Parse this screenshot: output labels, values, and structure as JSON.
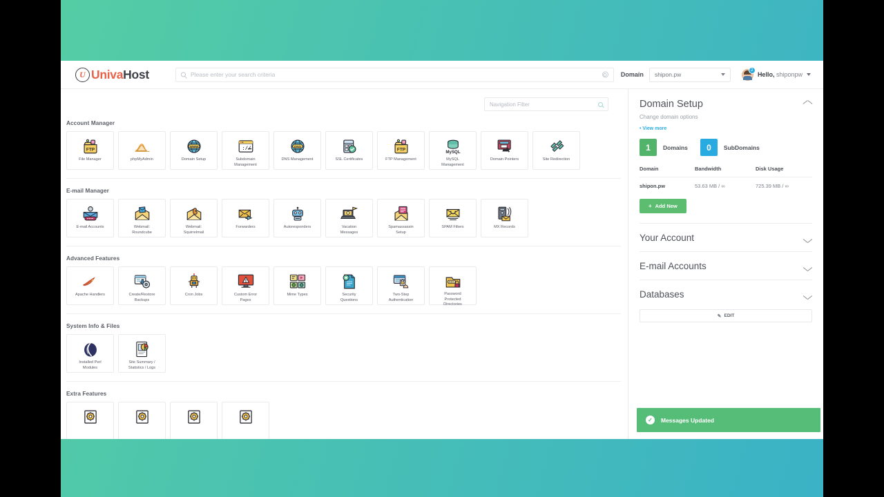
{
  "header": {
    "logo_mark": "U",
    "logo_text_a": "Univa",
    "logo_text_b": "Host",
    "search_placeholder": "Please enter your search criteria",
    "domain_label": "Domain",
    "domain_value": "shipon.pw",
    "notification_count": "2",
    "greeting_prefix": "Hello,",
    "greeting_user": "shiponpw"
  },
  "main": {
    "nav_filter_placeholder": "Navigation Filter",
    "sections": [
      {
        "title": "Account Manager",
        "tiles": [
          {
            "label": "File Manager",
            "icon": "ftp-folder-icon"
          },
          {
            "label": "phpMyAdmin",
            "icon": "phpmyadmin-icon"
          },
          {
            "label": "Domain Setup",
            "icon": "www-globe-icon"
          },
          {
            "label": "Subdomain\nManagement",
            "icon": "browser-window-icon"
          },
          {
            "label": "DNS Management",
            "icon": "dns-globe-icon"
          },
          {
            "label": "SSL Certificates",
            "icon": "ssl-shield-icon"
          },
          {
            "label": "FTP Management",
            "icon": "ftp-folder-icon"
          },
          {
            "label": "MySQL\nManagement",
            "icon": "mysql-database-icon"
          },
          {
            "label": "Domain Pointers",
            "icon": "monitor-pointer-icon"
          },
          {
            "label": "Site Redirection",
            "icon": "redirect-arrows-icon"
          }
        ]
      },
      {
        "title": "E-mail Manager",
        "tiles": [
          {
            "label": "E-mail Accounts",
            "icon": "email-account-icon"
          },
          {
            "label": "Webmail:\nRoundcube",
            "icon": "roundcube-envelope-icon"
          },
          {
            "label": "Webmail:\nSquirrelmail",
            "icon": "squirrelmail-envelope-icon"
          },
          {
            "label": "Forwarders",
            "icon": "forwarder-envelope-icon"
          },
          {
            "label": "Autoresponders",
            "icon": "robot-icon"
          },
          {
            "label": "Vacation\nMessages",
            "icon": "vacation-laptop-icon"
          },
          {
            "label": "Spamassassin\nSetup",
            "icon": "spamassassin-envelope-icon"
          },
          {
            "label": "SPAM Filters",
            "icon": "spam-filter-icon"
          },
          {
            "label": "MX Records",
            "icon": "mx-server-icon"
          }
        ]
      },
      {
        "title": "Advanced Features",
        "tiles": [
          {
            "label": "Apache Handlers",
            "icon": "apache-feather-icon"
          },
          {
            "label": "Create/Restore\nBackups",
            "icon": "backup-icon"
          },
          {
            "label": "Cron Jobs",
            "icon": "cron-robot-icon"
          },
          {
            "label": "Custom Error\nPages",
            "icon": "error-monitor-icon"
          },
          {
            "label": "Mime Types",
            "icon": "mime-types-icon"
          },
          {
            "label": "Security\nQuestions",
            "icon": "security-questions-icon"
          },
          {
            "label": "Two-Step\nAuthentication",
            "icon": "two-step-auth-icon"
          },
          {
            "label": "Password\nProtected\nDirectories",
            "icon": "password-folder-icon"
          }
        ]
      },
      {
        "title": "System Info & Files",
        "tiles": [
          {
            "label": "Installed Perl\nModules",
            "icon": "perl-onion-icon"
          },
          {
            "label": "Site Summary /\nStatistics / Logs",
            "icon": "site-stats-icon"
          }
        ]
      },
      {
        "title": "Extra Features",
        "tiles": [
          {
            "label": "",
            "icon": "gear-box-icon"
          },
          {
            "label": "",
            "icon": "gear-box-icon"
          },
          {
            "label": "",
            "icon": "gear-box-icon"
          },
          {
            "label": "",
            "icon": "gear-box-icon"
          }
        ]
      }
    ]
  },
  "sidebar": {
    "domain_setup": {
      "title": "Domain Setup",
      "subtitle": "Change domain options",
      "view_more": "View more",
      "domains_count": "1",
      "domains_label": "Domains",
      "subdomains_count": "0",
      "subdomains_label": "SubDomains",
      "table_headers": [
        "Domain",
        "Bandwidth",
        "Disk Usage"
      ],
      "rows": [
        {
          "domain": "shipon.pw",
          "bandwidth": "53.63 MB / ∞",
          "disk": "725.39 MB / ∞"
        }
      ],
      "add_new_label": "Add New",
      "add_new_plus": "+"
    },
    "accordion": [
      {
        "title": "Your Account"
      },
      {
        "title": "E-mail Accounts"
      },
      {
        "title": "Databases"
      }
    ],
    "edit_label": "EDIT",
    "edit_icon": "✎"
  },
  "toast": {
    "message": "Messages Updated",
    "icon": "✓",
    "color": "#56bd78"
  },
  "colors": {
    "brand_red": "#e8634a",
    "accent_blue": "#29abe2",
    "accent_green": "#52b46a",
    "bg_gradient_start": "#55cda4",
    "bg_gradient_end": "#3bb2c6"
  }
}
